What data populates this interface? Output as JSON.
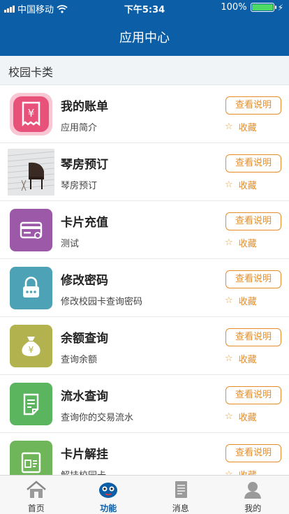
{
  "status_bar": {
    "carrier": "中国移动",
    "time": "下午5:34",
    "battery": "100%"
  },
  "header": {
    "title": "应用中心"
  },
  "section": {
    "title": "校园卡类"
  },
  "items": [
    {
      "title": "我的账单",
      "desc": "应用简介",
      "button": "查看说明",
      "fav": "收藏",
      "icon": "bill-icon",
      "color": "#e8527a"
    },
    {
      "title": "琴房预订",
      "desc": "琴房预订",
      "button": "查看说明",
      "fav": "收藏",
      "icon": "piano-photo",
      "color": "#d9d9d9"
    },
    {
      "title": "卡片充值",
      "desc": "测试",
      "button": "查看说明",
      "fav": "收藏",
      "icon": "card-icon",
      "color": "#9b59a8"
    },
    {
      "title": "修改密码",
      "desc": "修改校园卡查询密码",
      "button": "查看说明",
      "fav": "收藏",
      "icon": "lock-icon",
      "color": "#4ea2b6"
    },
    {
      "title": "余额查询",
      "desc": "查询余额",
      "button": "查看说明",
      "fav": "收藏",
      "icon": "money-bag-icon",
      "color": "#b2b24e"
    },
    {
      "title": "流水查询",
      "desc": "查询你的交易流水",
      "button": "查看说明",
      "fav": "收藏",
      "icon": "document-icon",
      "color": "#5bb55e"
    },
    {
      "title": "卡片解挂",
      "desc": "解挂校园卡",
      "button": "查看说明",
      "fav": "收藏",
      "icon": "id-card-icon",
      "color": "#6fb65a"
    }
  ],
  "tabs": [
    {
      "label": "首页",
      "icon": "home-icon",
      "active": false
    },
    {
      "label": "功能",
      "icon": "function-icon",
      "active": true
    },
    {
      "label": "消息",
      "icon": "message-icon",
      "active": false
    },
    {
      "label": "我的",
      "icon": "profile-icon",
      "active": false
    }
  ],
  "colors": {
    "brand": "#0c5ea6",
    "accent": "#e38e2a"
  }
}
